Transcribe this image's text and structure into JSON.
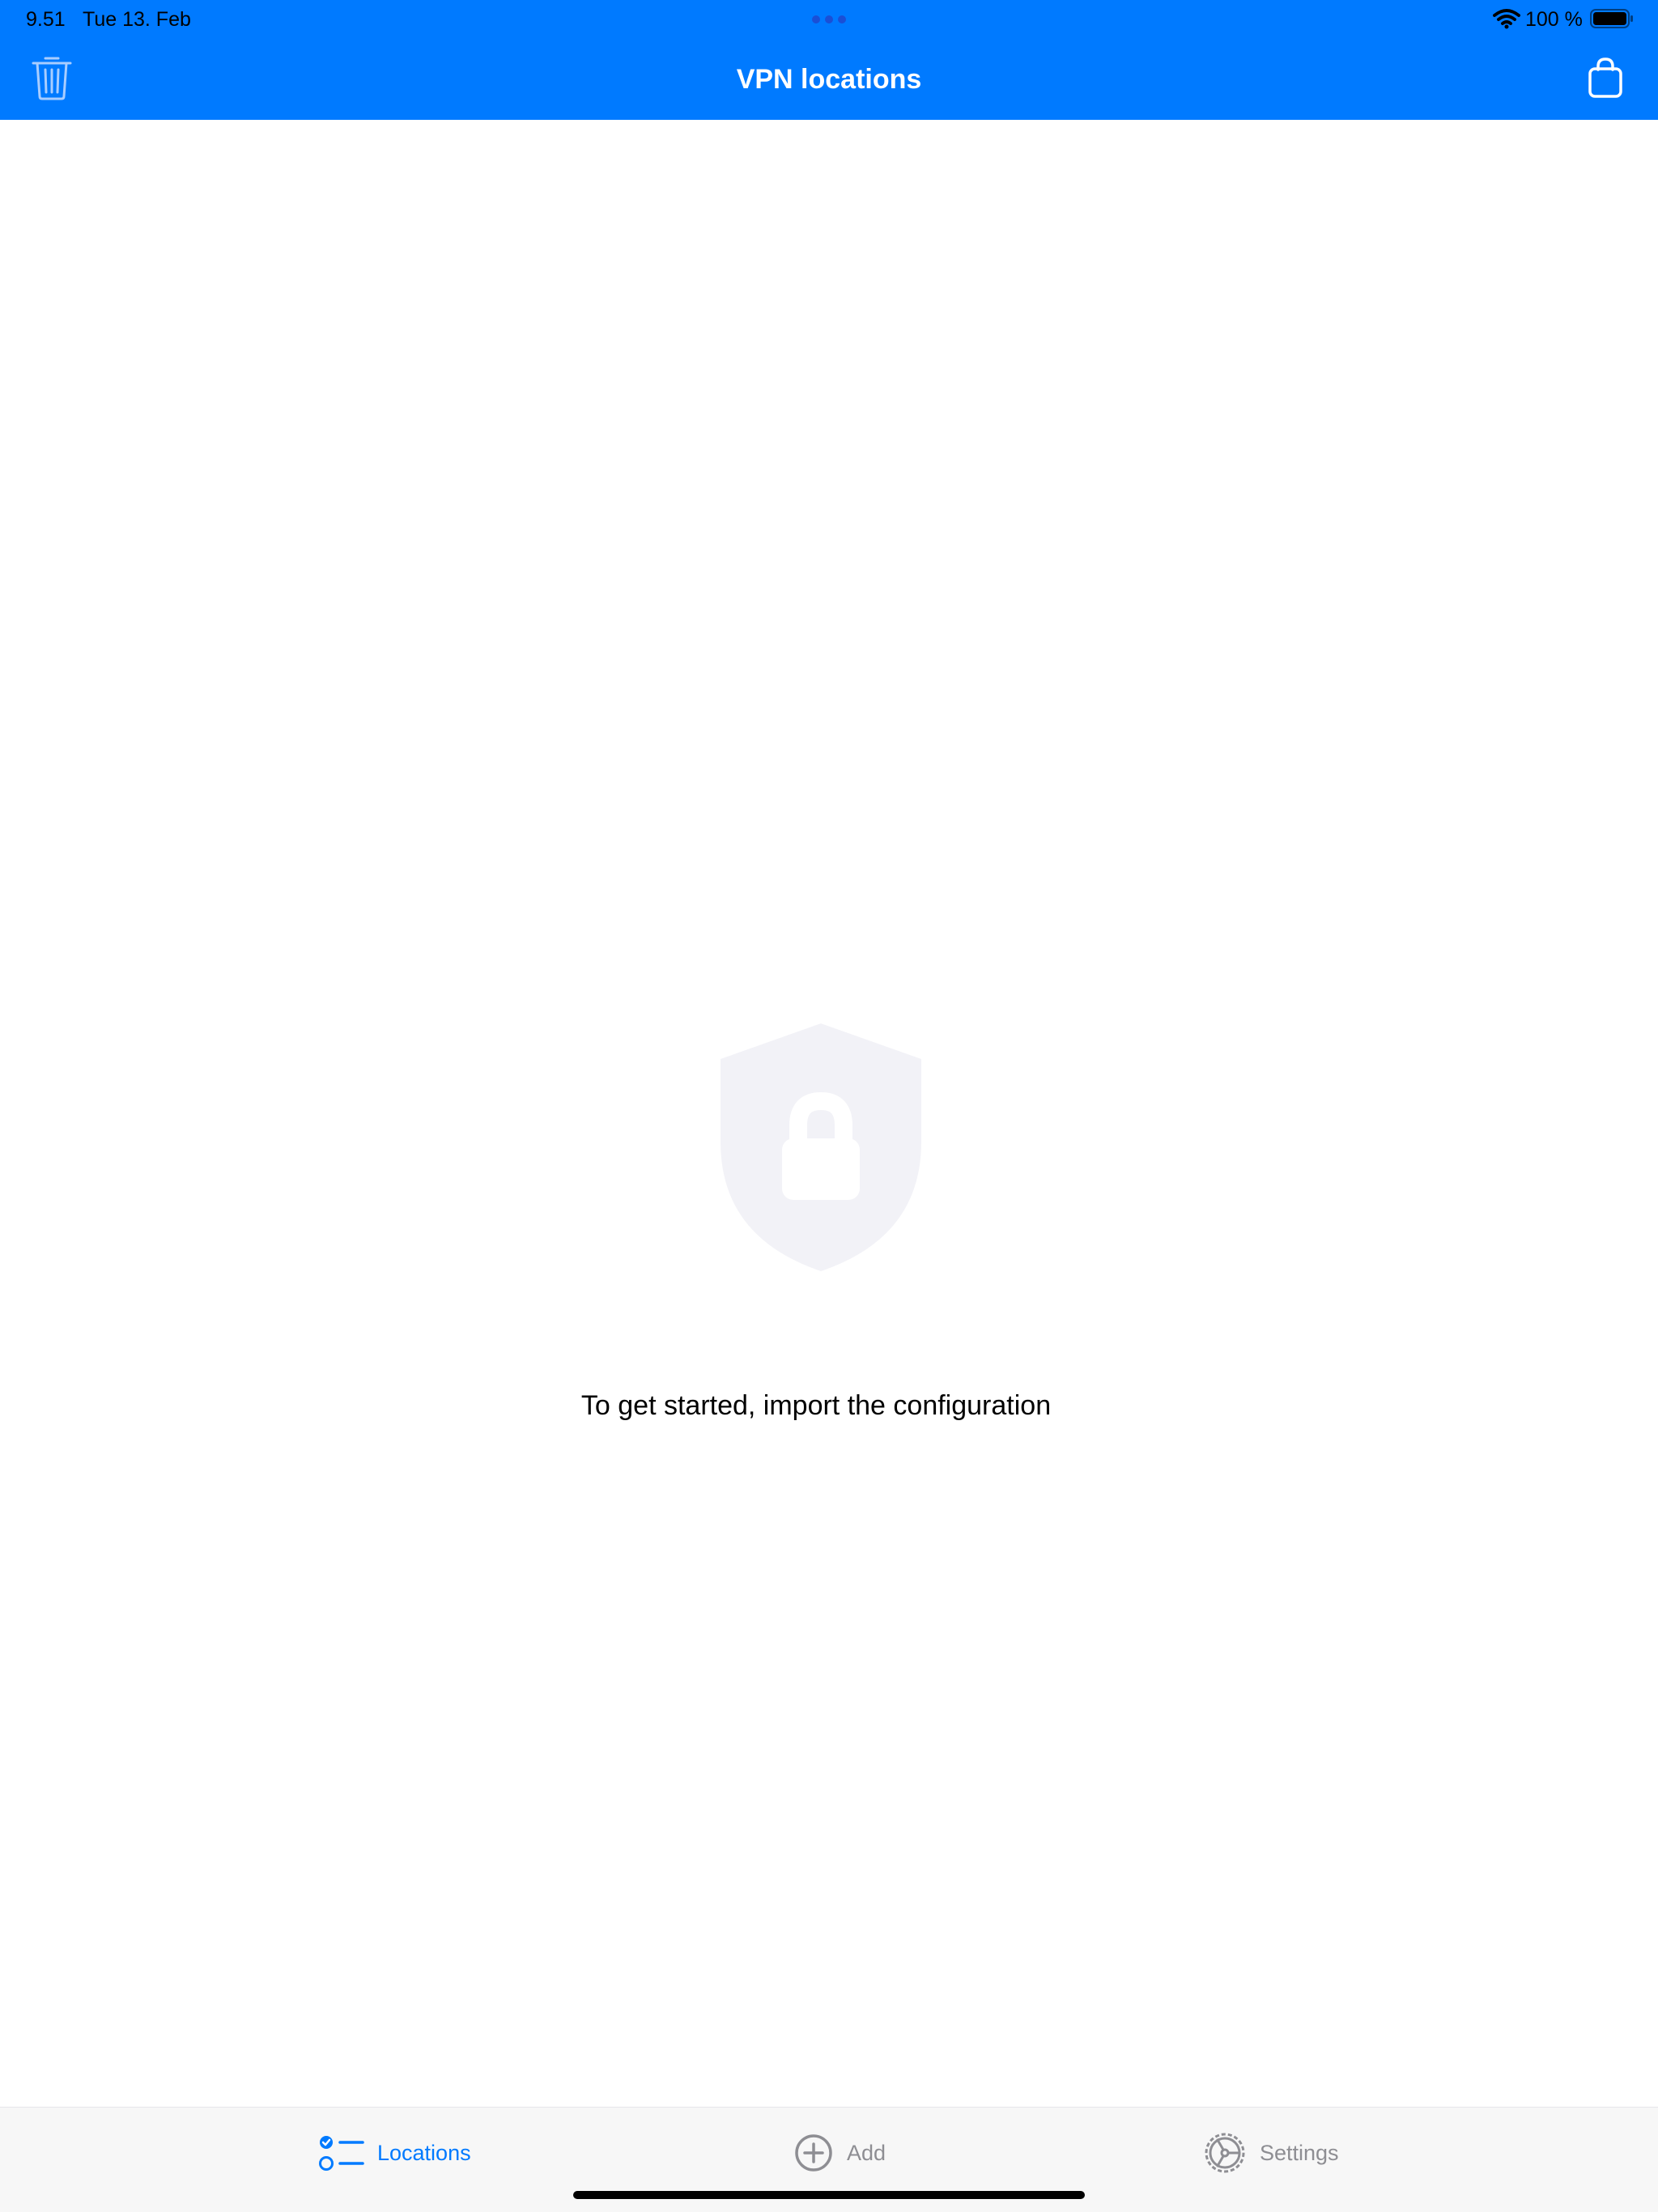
{
  "status_bar": {
    "time": "9.51",
    "date": "Tue 13. Feb",
    "battery_text": "100 %"
  },
  "nav": {
    "title": "VPN locations",
    "left_icon": "trash-icon",
    "right_icon": "bag-icon"
  },
  "empty_state": {
    "icon": "shield-lock-icon",
    "message": "To get started, import the configuration"
  },
  "tabs": [
    {
      "label": "Locations",
      "icon": "checklist-icon",
      "active": true
    },
    {
      "label": "Add",
      "icon": "plus-circle-icon",
      "active": false
    },
    {
      "label": "Settings",
      "icon": "gear-icon",
      "active": false
    }
  ],
  "colors": {
    "accent": "#007AFF",
    "header_bg": "#007AFF",
    "tab_bar_bg": "#F7F7F7",
    "inactive_tab": "#8E8E93",
    "shield_fill": "#F2F2F7",
    "text": "#000000",
    "background": "#FFFFFF"
  }
}
